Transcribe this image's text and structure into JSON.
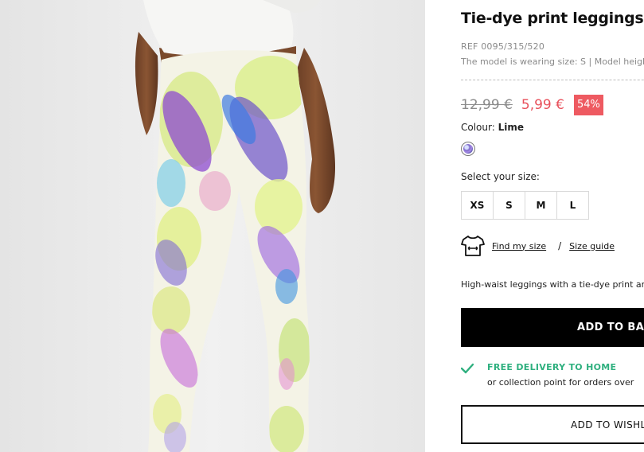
{
  "product": {
    "title": "Tie-dye print leggings",
    "ref": "REF 0095/315/520",
    "model_info": "The model is wearing size: S | Model height",
    "old_price": "12,99 €",
    "new_price": "5,99 €",
    "discount": "54%",
    "colour_label": "Colour:",
    "colour_value": "Lime",
    "description": "High-waist leggings with a tie-dye print and"
  },
  "sizes": {
    "label": "Select your size:",
    "options": [
      "XS",
      "S",
      "M",
      "L"
    ]
  },
  "size_help": {
    "find": "Find my size",
    "separator": "/",
    "guide": "Size guide"
  },
  "actions": {
    "add_to_basket": "ADD TO BASKET",
    "wishlist": "ADD TO WISHLIST"
  },
  "delivery": {
    "headline": "FREE DELIVERY TO HOME",
    "detail": "or collection point for orders over"
  },
  "icons": {
    "size": "tshirt-icon",
    "delivery": "check-icon",
    "wishlist": "heart-icon"
  },
  "colors": {
    "sale_price": "#e8505b",
    "discount_badge": "#ee5a61",
    "delivery_green": "#2fb07f",
    "button_black": "#000000"
  }
}
